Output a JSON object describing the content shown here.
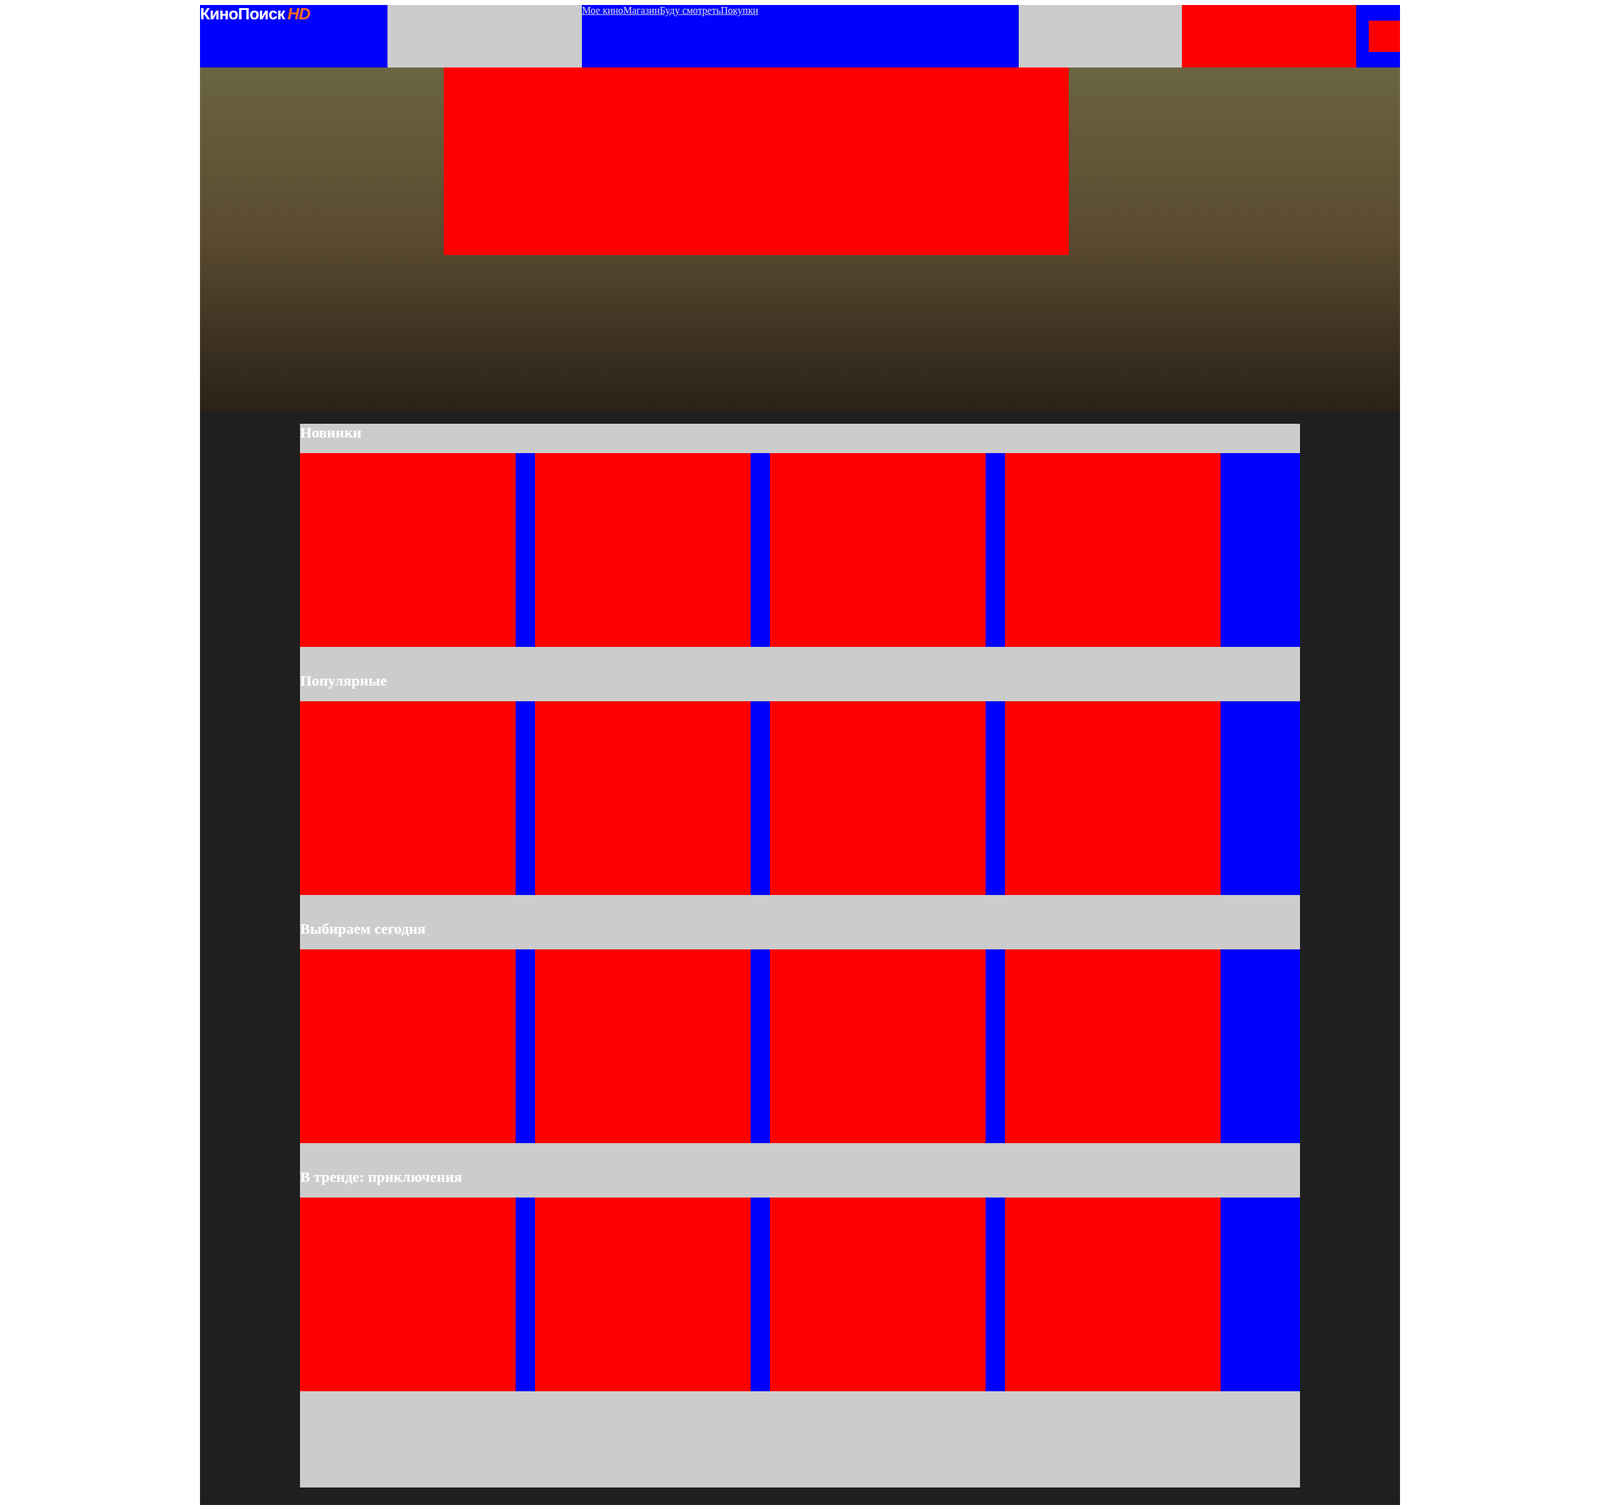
{
  "header": {
    "logo": {
      "text": "КиноПоиск",
      "badge": "HD"
    },
    "nav": [
      {
        "label": "Мое кино"
      },
      {
        "label": "Магазин"
      },
      {
        "label": "Буду смотреть"
      },
      {
        "label": "Покупки"
      }
    ]
  },
  "sections": [
    {
      "title": "Новинки"
    },
    {
      "title": "Популярные"
    },
    {
      "title": "Выбираем сегодня"
    },
    {
      "title": "В тренде: приключения"
    }
  ]
}
